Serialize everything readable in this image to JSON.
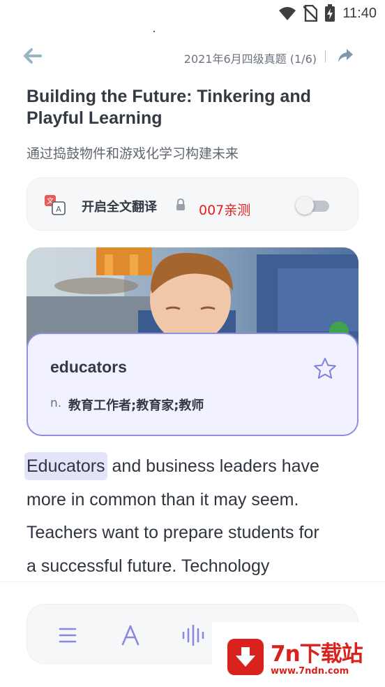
{
  "status_bar": {
    "time": "11:40",
    "icons": [
      "wifi-icon",
      "no-sim-icon",
      "battery-charging-icon"
    ]
  },
  "header": {
    "back_icon": "arrow-left-icon",
    "title": "2021年6月四级真题 (1/6)",
    "share_icon": "share-arrow-icon"
  },
  "article": {
    "title": "Building the Future: Tinkering and Playful Learning",
    "subtitle": "通过捣鼓物件和游戏化学习构建未来",
    "highlighted_word": "Educators",
    "body_lines": [
      " and business leaders have",
      "more in common than it may seem.",
      "Teachers want to prepare students for",
      "a successful future. Technology"
    ]
  },
  "translation": {
    "label": "开启全文翻译",
    "promo": "007亲测",
    "enabled": false,
    "icon": "translate-icon",
    "lock_icon": "lock-icon"
  },
  "definition_popup": {
    "word": "educators",
    "part_of_speech": "n.",
    "meaning": "教育工作者;教育家;教师",
    "star_icon": "star-outline-icon"
  },
  "toolbar": {
    "items": [
      "list-icon",
      "font-size-icon",
      "audio-wave-icon"
    ]
  },
  "watermark": {
    "title": "7n下载站",
    "url": "www.7ndn.com"
  },
  "colors": {
    "accent": "#7f7fdd",
    "popup_border": "#8f8ee0",
    "popup_bg": "#f1f2fd",
    "promo_red": "#e02020",
    "watermark_red": "#d8221e"
  }
}
